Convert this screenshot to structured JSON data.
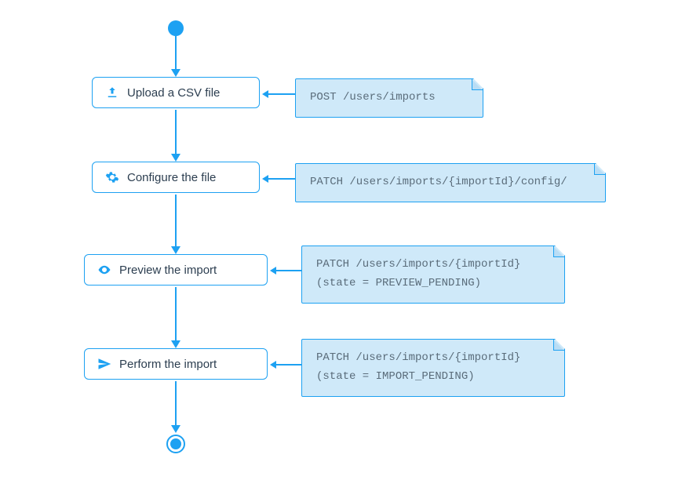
{
  "diagram": {
    "steps": [
      {
        "label": "Upload a CSV file",
        "icon": "upload-icon"
      },
      {
        "label": "Configure the file",
        "icon": "gear-icon"
      },
      {
        "label": "Preview the import",
        "icon": "eye-icon"
      },
      {
        "label": "Perform the import",
        "icon": "send-icon"
      }
    ],
    "notes": [
      {
        "lines": [
          "POST /users/imports"
        ]
      },
      {
        "lines": [
          "PATCH /users/imports/{importId}/config/"
        ]
      },
      {
        "lines": [
          "PATCH /users/imports/{importId}",
          "(state = PREVIEW_PENDING)"
        ]
      },
      {
        "lines": [
          "PATCH /users/imports/{importId}",
          "(state = IMPORT_PENDING)"
        ]
      }
    ],
    "colors": {
      "accent": "#1da1f2",
      "noteFill": "#cfe9f9",
      "text": "#2c3e50",
      "code": "#5a6c7a"
    }
  }
}
